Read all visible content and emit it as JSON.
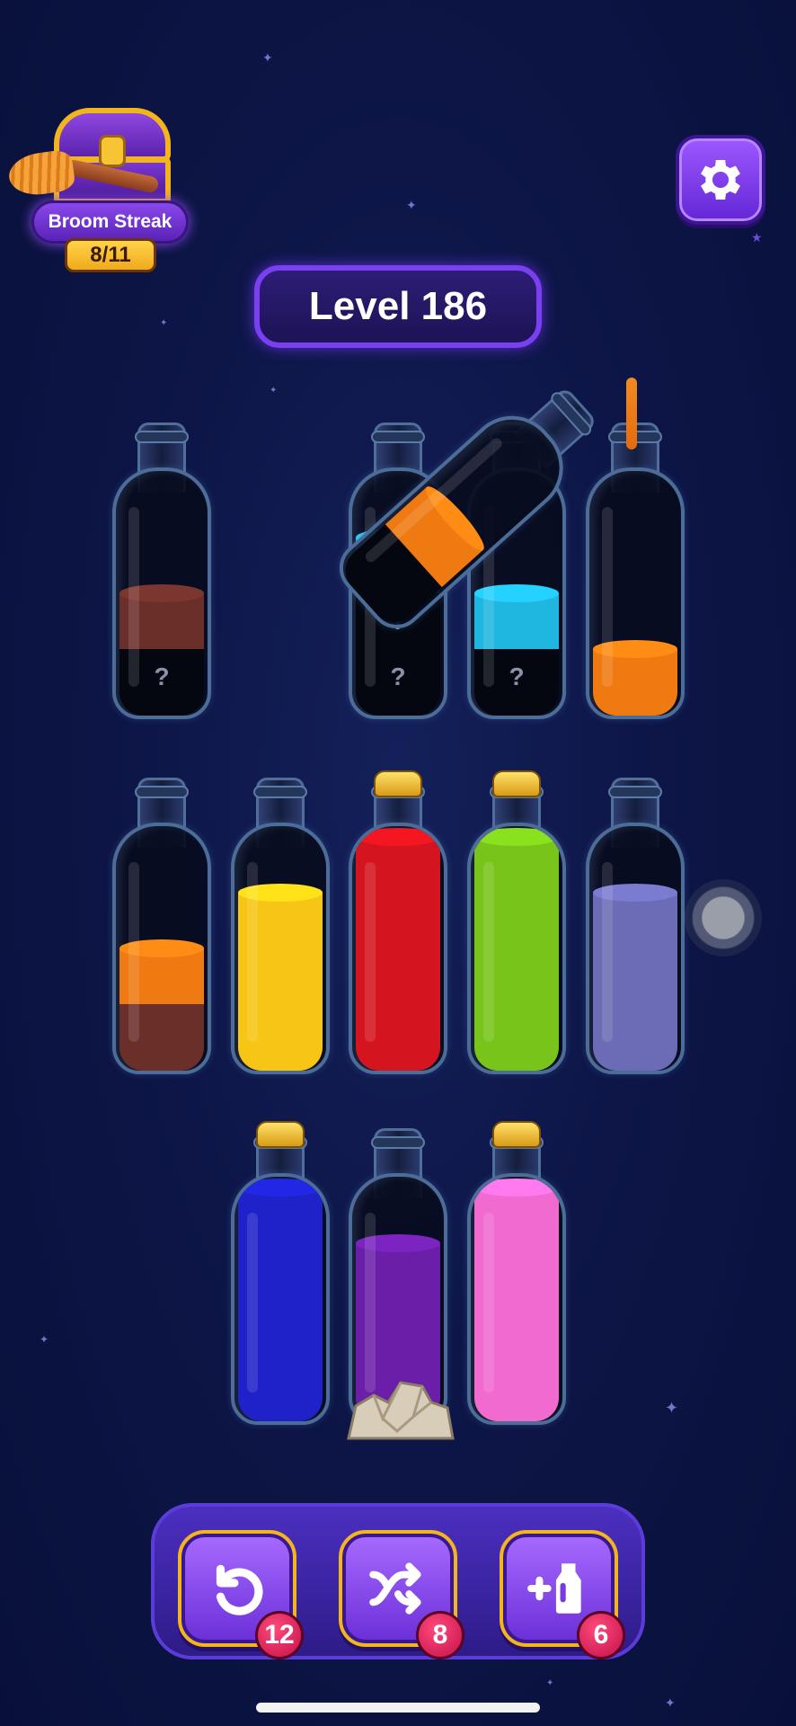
{
  "streak": {
    "title": "Broom Streak",
    "progress": "8/11",
    "progress_value": 0.727
  },
  "level": {
    "label": "Level 186"
  },
  "hidden_marker": "?",
  "bottles": [
    {
      "id": "r1c1",
      "corked": false,
      "layers": [
        {
          "color": "#050710",
          "hidden": true
        },
        {
          "color": "#6b2f2a"
        }
      ]
    },
    {
      "id": "r1c3",
      "corked": false,
      "layers": [
        {
          "color": "#050710",
          "hidden": true
        },
        {
          "color": "#050710",
          "hidden": true
        },
        {
          "color": "#1fb6e0"
        }
      ]
    },
    {
      "id": "r1c4",
      "corked": false,
      "layers": [
        {
          "color": "#050710",
          "hidden": true
        },
        {
          "color": "#1fb6e0"
        }
      ]
    },
    {
      "id": "r1c5",
      "corked": false,
      "layers": [
        {
          "color": "#f07a12"
        }
      ]
    },
    {
      "id": "pouring",
      "corked": false,
      "layers": [
        {
          "color": "#050710"
        },
        {
          "color": "#f07a12"
        }
      ]
    },
    {
      "id": "r2c1",
      "corked": false,
      "layers": [
        {
          "color": "#6b2f2a"
        },
        {
          "color": "#f07a12"
        }
      ]
    },
    {
      "id": "r2c2",
      "corked": false,
      "layers": [
        {
          "color": "#f7c515"
        },
        {
          "color": "#f7c515"
        },
        {
          "color": "#f7c515"
        }
      ]
    },
    {
      "id": "r2c3",
      "corked": true,
      "layers": [
        {
          "color": "#d4141e"
        },
        {
          "color": "#d4141e"
        },
        {
          "color": "#d4141e"
        },
        {
          "color": "#d4141e"
        }
      ]
    },
    {
      "id": "r2c4",
      "corked": true,
      "layers": [
        {
          "color": "#78c41a"
        },
        {
          "color": "#78c41a"
        },
        {
          "color": "#78c41a"
        },
        {
          "color": "#78c41a"
        }
      ]
    },
    {
      "id": "r2c5",
      "corked": false,
      "layers": [
        {
          "color": "#6b6bb6"
        },
        {
          "color": "#6b6bb6"
        },
        {
          "color": "#6b6bb6"
        }
      ]
    },
    {
      "id": "r3c2",
      "corked": true,
      "layers": [
        {
          "color": "#1e22c8"
        },
        {
          "color": "#1e22c8"
        },
        {
          "color": "#1e22c8"
        },
        {
          "color": "#1e22c8"
        }
      ]
    },
    {
      "id": "r3c3",
      "corked": false,
      "rock": true,
      "layers": [
        {
          "color": "#6b1fa8"
        },
        {
          "color": "#6b1fa8"
        },
        {
          "color": "#6b1fa8"
        }
      ]
    },
    {
      "id": "r3c4",
      "corked": true,
      "layers": [
        {
          "color": "#f06ad0"
        },
        {
          "color": "#f06ad0"
        },
        {
          "color": "#f06ad0"
        },
        {
          "color": "#f06ad0"
        }
      ]
    }
  ],
  "toolbar": {
    "undo": {
      "icon": "undo-icon",
      "count": "12"
    },
    "shuffle": {
      "icon": "shuffle-icon",
      "count": "8"
    },
    "add_bottle": {
      "icon": "add-bottle-icon",
      "count": "6"
    }
  },
  "colors": {
    "accent": "#7a3ff0",
    "gold": "#f3b51c",
    "badge": "#d41a52"
  }
}
